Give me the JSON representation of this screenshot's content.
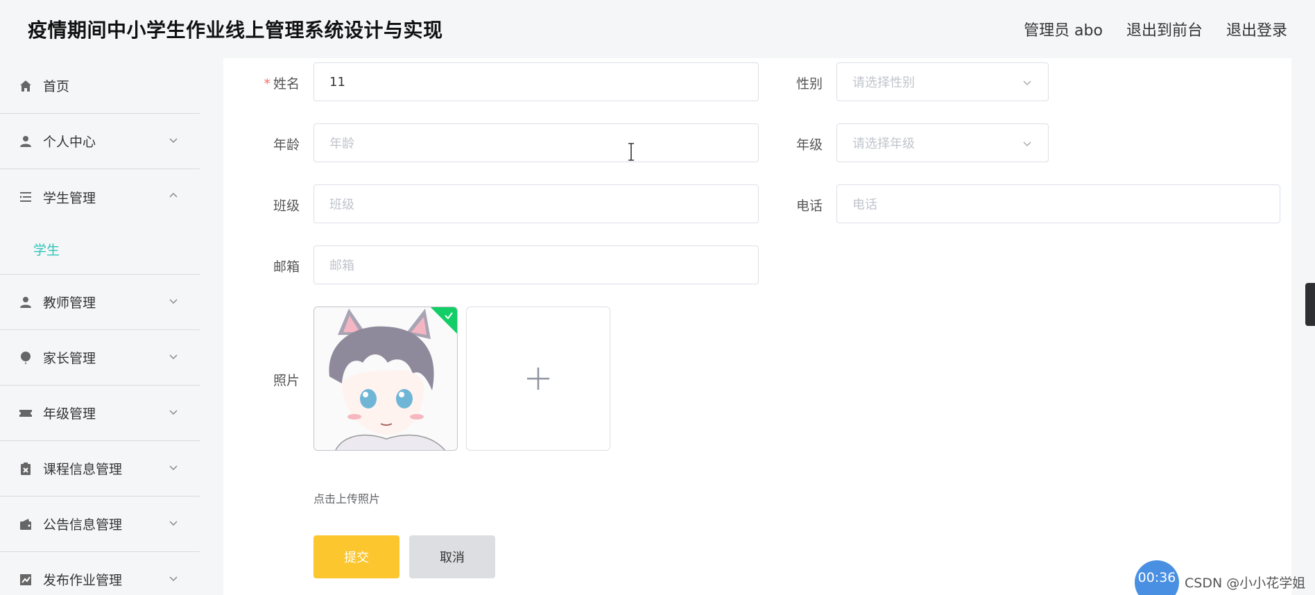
{
  "header": {
    "title": "疫情期间中小学生作业线上管理系统设计与实现",
    "user_label": "管理员 abo",
    "back_to_front": "退出到前台",
    "logout": "退出登录"
  },
  "sidebar": {
    "items": [
      {
        "label": "首页",
        "icon": "home-icon"
      },
      {
        "label": "个人中心",
        "icon": "user-icon"
      },
      {
        "label": "学生管理",
        "icon": "list-icon"
      },
      {
        "label": "教师管理",
        "icon": "user-icon"
      },
      {
        "label": "家长管理",
        "icon": "balloon-icon"
      },
      {
        "label": "年级管理",
        "icon": "ticket-icon"
      },
      {
        "label": "课程信息管理",
        "icon": "clipboard-icon"
      },
      {
        "label": "公告信息管理",
        "icon": "wallet-icon"
      },
      {
        "label": "发布作业管理",
        "icon": "chart-icon"
      }
    ],
    "student_sub": "学生"
  },
  "form": {
    "name_label": "姓名",
    "name_value": "11",
    "gender_label": "性别",
    "gender_placeholder": "请选择性别",
    "age_label": "年龄",
    "age_placeholder": "年龄",
    "grade_label": "年级",
    "grade_placeholder": "请选择年级",
    "class_label": "班级",
    "class_placeholder": "班级",
    "phone_label": "电话",
    "phone_placeholder": "电话",
    "email_label": "邮箱",
    "email_placeholder": "邮箱",
    "photo_label": "照片",
    "upload_tip": "点击上传照片",
    "submit": "提交",
    "cancel": "取消"
  },
  "overlay": {
    "timer": "00:36",
    "watermark": "CSDN @小小花学姐"
  },
  "colors": {
    "accent": "#2ec4b6",
    "submit": "#fcc62e",
    "required": "#f56c6c",
    "success_badge": "#13ce66"
  }
}
